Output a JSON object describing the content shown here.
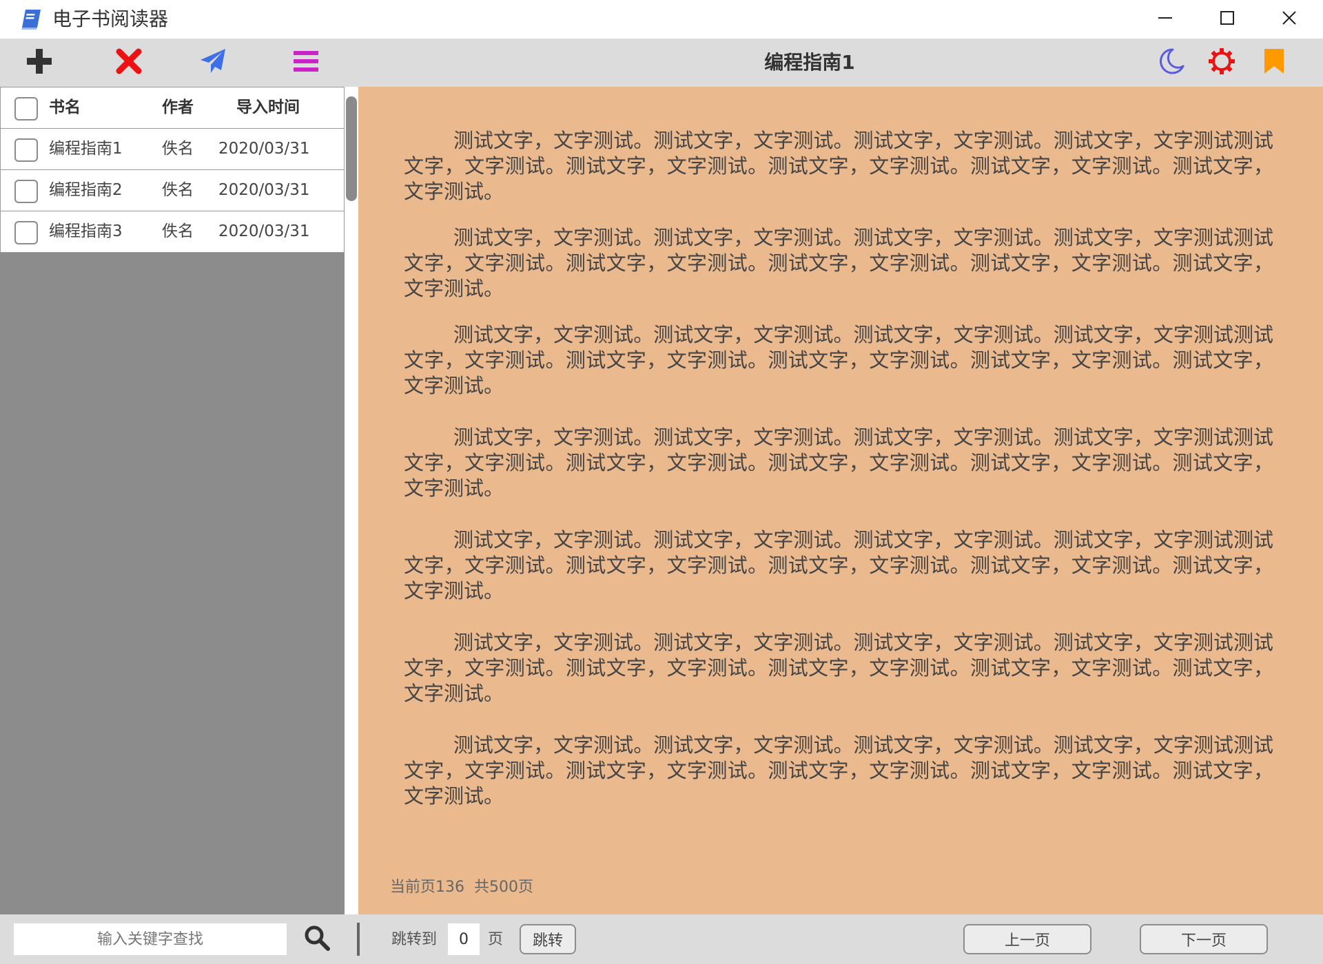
{
  "window": {
    "title": "电子书阅读器",
    "icons": [
      "book-icon",
      "minimize-icon",
      "maximize-icon",
      "close-icon"
    ]
  },
  "toolbar": {
    "icons": [
      {
        "name": "add-icon",
        "color": "#333333"
      },
      {
        "name": "delete-icon",
        "color": "#ee1111"
      },
      {
        "name": "send-icon",
        "color": "#3f6fe8"
      },
      {
        "name": "menu-icon",
        "color": "#cc22cc"
      },
      {
        "name": "moon-icon",
        "color": "#5a5ae0"
      },
      {
        "name": "gear-icon",
        "color": "#e81414"
      },
      {
        "name": "bookmark-icon",
        "color": "#ff9900"
      }
    ],
    "book_title": "编程指南1"
  },
  "book_table": {
    "headers": {
      "name": "书名",
      "author": "作者",
      "import_time": "导入时间"
    },
    "rows": [
      {
        "name": "编程指南1",
        "author": "佚名",
        "date": "2020/03/31"
      },
      {
        "name": "编程指南2",
        "author": "佚名",
        "date": "2020/03/31"
      },
      {
        "name": "编程指南3",
        "author": "佚名",
        "date": "2020/03/31"
      }
    ]
  },
  "reader": {
    "background": "#ebb98e",
    "paragraphs": [
      "测试文字，文字测试。测试文字，文字测试。测试文字，文字测试。测试文字，文字测试测试文字，文字测试。测试文字，文字测试。测试文字，文字测试。测试文字，文字测试。测试文字，文字测试。",
      "测试文字，文字测试。测试文字，文字测试。测试文字，文字测试。测试文字，文字测试测试文字，文字测试。测试文字，文字测试。测试文字，文字测试。测试文字，文字测试。测试文字，文字测试。",
      "测试文字，文字测试。测试文字，文字测试。测试文字，文字测试。测试文字，文字测试测试文字，文字测试。测试文字，文字测试。测试文字，文字测试。测试文字，文字测试。测试文字，文字测试。",
      "测试文字，文字测试。测试文字，文字测试。测试文字，文字测试。测试文字，文字测试测试文字，文字测试。测试文字，文字测试。测试文字，文字测试。测试文字，文字测试。测试文字，文字测试。",
      "测试文字，文字测试。测试文字，文字测试。测试文字，文字测试。测试文字，文字测试测试文字，文字测试。测试文字，文字测试。测试文字，文字测试。测试文字，文字测试。测试文字，文字测试。",
      "测试文字，文字测试。测试文字，文字测试。测试文字，文字测试。测试文字，文字测试测试文字，文字测试。测试文字，文字测试。测试文字，文字测试。测试文字，文字测试。测试文字，文字测试。",
      "测试文字，文字测试。测试文字，文字测试。测试文字，文字测试。测试文字，文字测试测试文字，文字测试。测试文字，文字测试。测试文字，文字测试。测试文字，文字测试。测试文字，文字测试。"
    ],
    "page_status": "当前页136  共500页"
  },
  "bottom_bar": {
    "search_placeholder": "输入关键字查找",
    "jump_label": "跳转到",
    "page_value": "0",
    "page_unit": "页",
    "jump_button": "跳转",
    "prev_button": "上一页",
    "next_button": "下一页"
  }
}
